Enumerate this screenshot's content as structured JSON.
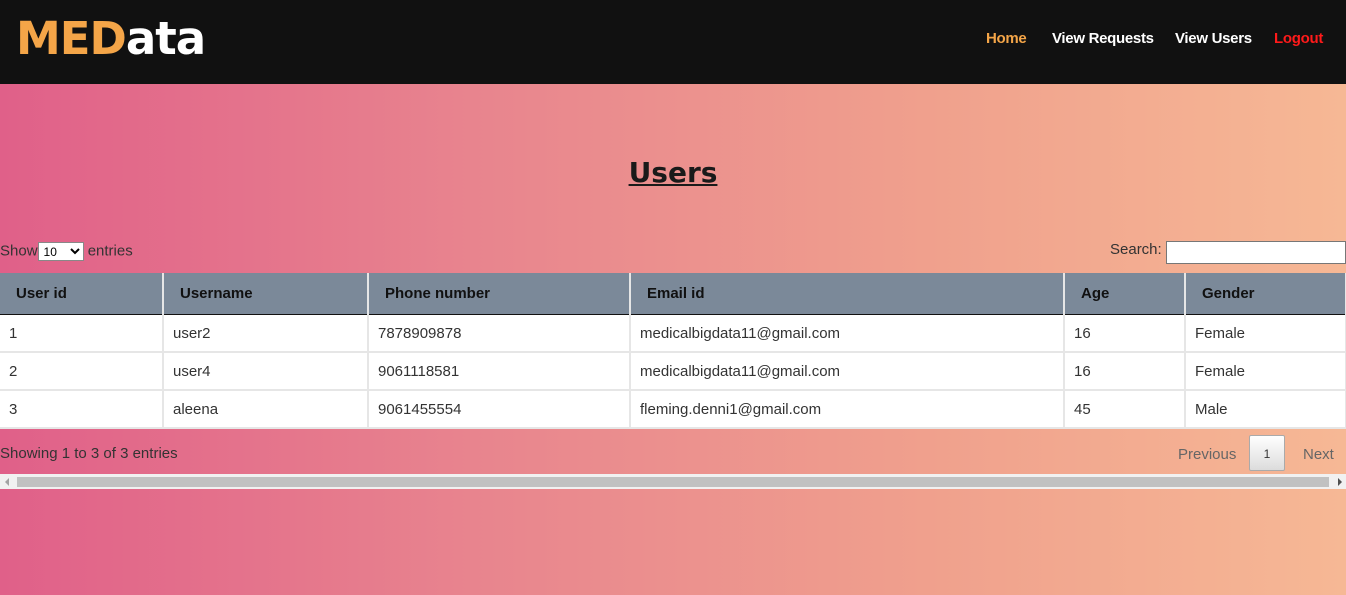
{
  "brand": {
    "part1": "MED",
    "part2": "ata",
    "d_letter": "D"
  },
  "nav": [
    {
      "label": "Home",
      "color": "#f4a548"
    },
    {
      "label": "View Requests",
      "color": "#ffffff"
    },
    {
      "label": "View Users",
      "color": "#ffffff"
    },
    {
      "label": "Logout",
      "color": "#ff1a1a"
    }
  ],
  "page_title": "Users",
  "length_menu": {
    "prefix": "Show",
    "selected": "10",
    "suffix": "entries"
  },
  "search": {
    "label": "Search:",
    "value": ""
  },
  "table": {
    "headers": [
      "User id",
      "Username",
      "Phone number",
      "Email id",
      "Age",
      "Gender"
    ],
    "rows": [
      [
        "1",
        "user2",
        "7878909878",
        "medicalbigdata11@gmail.com",
        "16",
        "Female"
      ],
      [
        "2",
        "user4",
        "9061118581",
        "medicalbigdata11@gmail.com",
        "16",
        "Female"
      ],
      [
        "3",
        "aleena",
        "9061455554",
        "fleming.denni1@gmail.com",
        "45",
        "Male"
      ]
    ]
  },
  "info": "Showing 1 to 3 of 3 entries",
  "pagination": {
    "previous": "Previous",
    "current": "1",
    "next": "Next"
  }
}
